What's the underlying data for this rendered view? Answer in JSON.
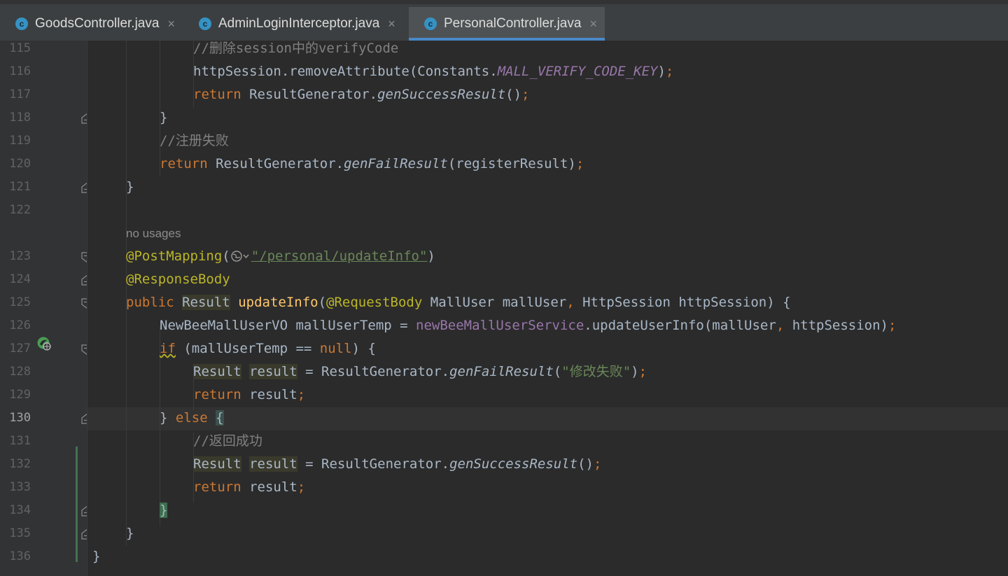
{
  "tabs": [
    {
      "label": "GoodsController.java",
      "icon": "java-class-icon",
      "icon_letter": "c",
      "close": "×",
      "active": false
    },
    {
      "label": "AdminLoginInterceptor.java",
      "icon": "java-class-icon",
      "icon_letter": "c",
      "close": "×",
      "active": false
    },
    {
      "label": "PersonalController.java",
      "icon": "java-class-icon",
      "icon_letter": "c",
      "close": "×",
      "active": true
    }
  ],
  "editor": {
    "current_line": "130",
    "line_numbers": [
      "115",
      "116",
      "117",
      "118",
      "119",
      "120",
      "121",
      "122",
      "123",
      "124",
      "125",
      "126",
      "127",
      "128",
      "129",
      "130",
      "131",
      "132",
      "133",
      "134",
      "135",
      "136"
    ],
    "inlay_hint": "no usages",
    "code": {
      "l115": {
        "comment": "//删除session中的verifyCode"
      },
      "l116": {
        "a": "httpSession.removeAttribute(Constants.",
        "const": "MALL_VERIFY_CODE_KEY",
        "b": ")",
        "semi": ";"
      },
      "l117": {
        "kw": "return",
        "a": " ResultGenerator.",
        "method": "genSuccessResult",
        "b": "()",
        "semi": ";"
      },
      "l118": {
        "brace": "}"
      },
      "l119": {
        "comment": "//注册失败"
      },
      "l120": {
        "kw": "return",
        "a": " ResultGenerator.",
        "method": "genFailResult",
        "b": "(registerResult)",
        "semi": ";"
      },
      "l121": {
        "brace": "}"
      },
      "l123": {
        "ann": "@PostMapping",
        "open": "(",
        "str": "\"/personal/updateInfo\"",
        "close": ")"
      },
      "l124": {
        "ann": "@ResponseBody"
      },
      "l125": {
        "kw": "public",
        "type": "Result",
        "name": "updateInfo",
        "open": "(",
        "ann": "@RequestBody",
        "p1": " MallUser mallUser",
        "comma": ",",
        "p2": " HttpSession httpSession) {"
      },
      "l126": {
        "a": "NewBeeMallUserVO mallUserTemp = ",
        "field": "newBeeMallUserService",
        "b": ".updateUserInfo(mallUser",
        "comma": ",",
        "c": " httpSession)",
        "semi": ";"
      },
      "l127": {
        "kw": "if",
        "a": " (mallUserTemp == ",
        "null": "null",
        "b": ") {"
      },
      "l128": {
        "type": "Result",
        "var": "result",
        "a": " = ResultGenerator.",
        "method": "genFailResult",
        "open": "(",
        "str": "\"修改失败\"",
        "close": ")",
        "semi": ";"
      },
      "l129": {
        "kw": "return",
        "a": " result",
        "semi": ";"
      },
      "l130": {
        "close": "} ",
        "kw": "else",
        "brace": "{"
      },
      "l131": {
        "comment": "//返回成功"
      },
      "l132": {
        "type": "Result",
        "var": "result",
        "a": " = ResultGenerator.",
        "method": "genSuccessResult",
        "b": "()",
        "semi": ";"
      },
      "l133": {
        "kw": "return",
        "a": " result",
        "semi": ";"
      },
      "l134": {
        "brace": "}"
      },
      "l135": {
        "brace": "}"
      },
      "l136": {
        "brace": "}"
      }
    }
  },
  "colors": {
    "background": "#2b2b2b",
    "gutter": "#313335",
    "keyword": "#cc7832",
    "string": "#6a8759",
    "comment": "#808080",
    "annotation": "#bbb529",
    "constant": "#9876aa",
    "method": "#ffc66d",
    "text": "#a9b7c6",
    "tab_accent": "#4a88c7"
  }
}
